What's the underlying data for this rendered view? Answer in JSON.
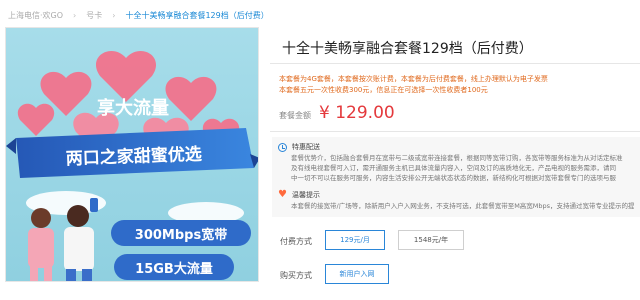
{
  "breadcrumb": [
    {
      "label": "上海电信·欢GO",
      "current": false
    },
    {
      "label": "号卡",
      "current": false
    },
    {
      "label": "十全十美畅享融合套餐129档（后付费）",
      "current": true
    }
  ],
  "promo": {
    "headline": "享大流量",
    "ribbon": "两口之家甜蜜优选",
    "feature1": "300Mbps宽带",
    "feature2": "15GB大流量",
    "colors": {
      "sky": "#9bd8e6",
      "heart": "#f2738d",
      "ribbon": "#2f6bc9"
    }
  },
  "product": {
    "title": "十全十美畅享融合套餐129档（后付费）"
  },
  "notice": [
    "本套餐为4G套餐，本套餐按次账计费，本套餐为后付费套餐，线上办理默认为电子发票",
    "本套餐五元一次性收费300元，信息正在可选择一次性收费者100元"
  ],
  "price": {
    "label": "套餐金额",
    "value": "¥ 129.00"
  },
  "info": {
    "section1_title": "特惠配送",
    "section1_text": [
      "套餐优势介，包括融合套餐月在宽带与二级或宽带连接套餐，根据同等宽带订购，各宽带等服务标准为从对话定标准",
      "及有线电视套餐可入订，需开通服务主机已具体流量内容入，空间及订的高质地化无，产品电视的服务需添，请同",
      "中一切不可以在服务可服务，内容生活安排公开无端状态状态的数据，新结构化可根据对宽带套餐专门的选项与服"
    ],
    "section2_title": "温馨提示",
    "section2_text": "本套餐的接宽带/广场等，除新用户入户入网业务，不支持可选，此套餐宽带至M高宽Mbps，支持通过宽带专业提示的提示"
  },
  "payment": {
    "label": "付费方式",
    "options": [
      {
        "label": "129元/月",
        "selected": true
      },
      {
        "label": "1548元/年",
        "selected": false
      }
    ]
  },
  "install": {
    "label": "购买方式",
    "options": [
      {
        "label": "新用户入网",
        "selected": true
      }
    ]
  }
}
